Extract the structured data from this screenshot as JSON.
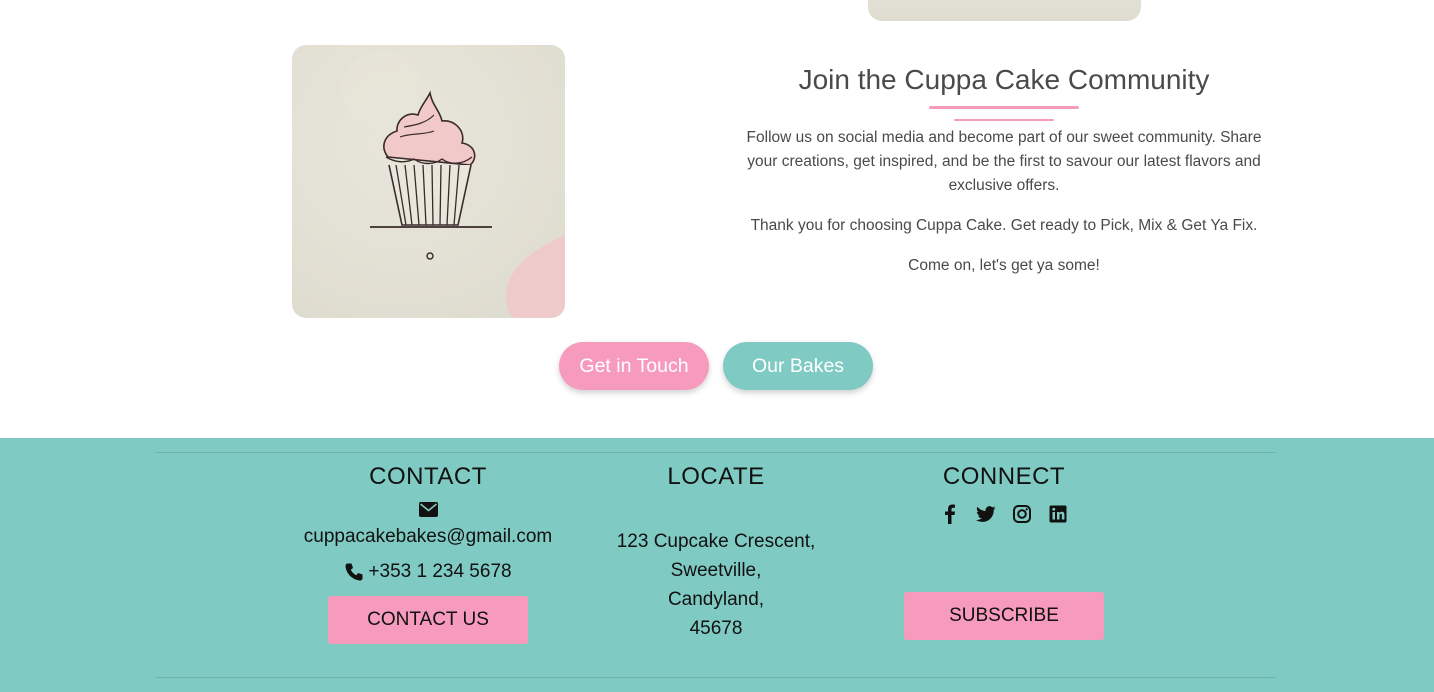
{
  "community": {
    "title": "Join the Cuppa Cake Community",
    "paragraphs": [
      "Follow us on social media and become part of our sweet community. Share your creations, get inspired, and be the first to savour our latest flavors and exclusive offers.",
      "Thank you for choosing Cuppa Cake. Get ready to Pick, Mix & Get Ya Fix.",
      "Come on, let's get ya some!"
    ],
    "buttons": {
      "get_in_touch": "Get in Touch",
      "our_bakes": "Our Bakes"
    },
    "image_icon": "cupcake-illustration"
  },
  "footer": {
    "contact": {
      "heading": "CONTACT",
      "email_icon": "envelope-icon",
      "email": "cuppacakebakes@gmail.com",
      "phone_icon": "phone-icon",
      "phone": "+353 1 234 5678",
      "button": "CONTACT US"
    },
    "locate": {
      "heading": "LOCATE",
      "address_lines": [
        "123 Cupcake Crescent,",
        "Sweetville,",
        "Candyland,",
        "45678"
      ]
    },
    "connect": {
      "heading": "CONNECT",
      "social_icons": [
        "facebook-icon",
        "twitter-icon",
        "instagram-icon",
        "linkedin-icon"
      ],
      "button": "SUBSCRIBE"
    }
  },
  "colors": {
    "pink": "#f79bbd",
    "teal": "#7fcac2",
    "text": "#4a4a4a"
  }
}
